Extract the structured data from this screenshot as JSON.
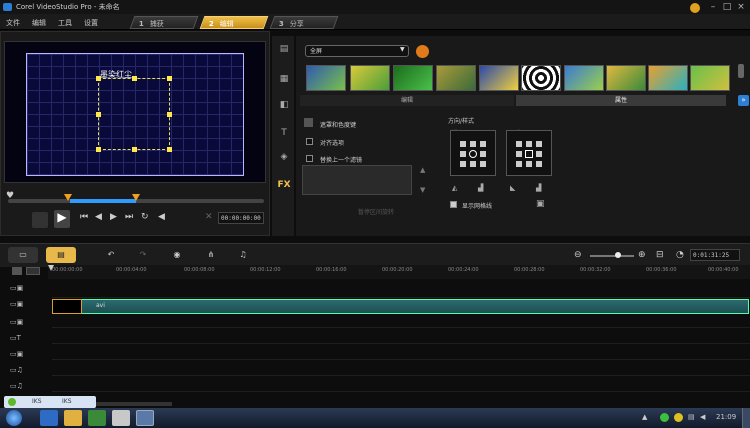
{
  "window": {
    "title": "Corel VideoStudio Pro - 未命名",
    "minimize_icon": "minimize-icon",
    "maximize_icon": "maximize-icon",
    "close_icon": "close-icon"
  },
  "menu": {
    "items": [
      "文件",
      "编辑",
      "工具",
      "设置"
    ]
  },
  "steps": [
    {
      "num": "1",
      "label": "捕获",
      "active": false
    },
    {
      "num": "2",
      "label": "编辑",
      "active": true
    },
    {
      "num": "3",
      "label": "分享",
      "active": false
    }
  ],
  "preview": {
    "overlay_text": "墨染红尘",
    "timecode": "00:00:00:00"
  },
  "library": {
    "category": "全屏",
    "subtabs": [
      "编辑",
      "属性"
    ],
    "options": [
      "遮罩和色度键",
      "对齐选项",
      "替换上一个滤镜"
    ],
    "direction_label": "方向/样式",
    "enter_label": "进入",
    "exit_label": "退出",
    "pause_label": "暂停区间旋转",
    "display_label": "显示网格线"
  },
  "timeline": {
    "timecode": "0:01:31:25",
    "ruler_labels": [
      "00:00:00:00",
      "00:00:04:00",
      "00:00:08:00",
      "00:00:12:00",
      "00:00:16:00",
      "00:00:20:00",
      "00:00:24:00",
      "00:00:28:00",
      "00:00:32:00",
      "00:00:36:00",
      "00:00:40:00"
    ],
    "clip_name": "avi"
  },
  "taskbar": {
    "clock": "21:09",
    "tray_pill_1": "IKS",
    "tray_pill_2": "IKS"
  },
  "colors": {
    "accent": "#e8b84a",
    "highlight": "#2f9bff"
  }
}
